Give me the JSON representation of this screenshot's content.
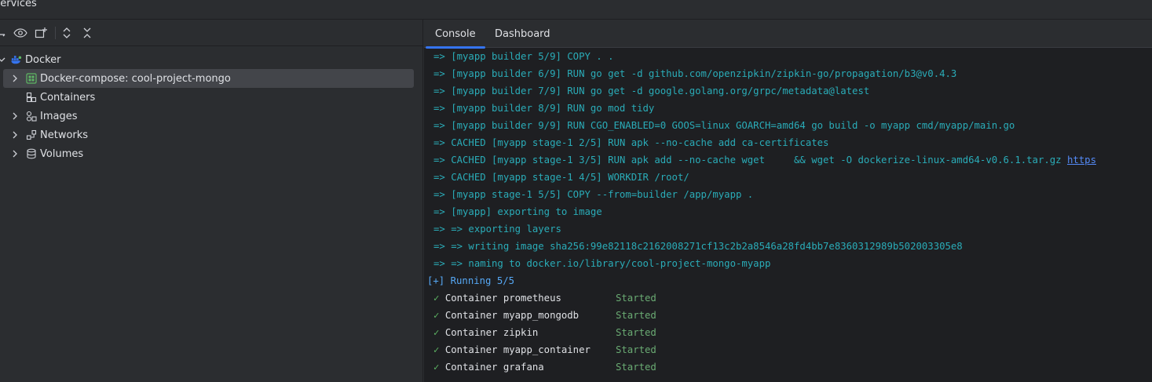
{
  "window": {
    "title": "Services"
  },
  "toolbar": {
    "buttons": [
      {
        "name": "collapse-option-icon"
      },
      {
        "name": "eye-icon"
      },
      {
        "name": "new-group-icon"
      },
      {
        "name": "expand-all-icon"
      },
      {
        "name": "collapse-all-icon"
      }
    ]
  },
  "tree": {
    "root": {
      "label": "Docker",
      "icon": "docker-icon"
    },
    "items": [
      {
        "label": "Docker-compose: cool-project-mongo",
        "icon": "compose-icon",
        "expandable": true,
        "selected": true
      },
      {
        "label": "Containers",
        "icon": "containers-icon",
        "expandable": false
      },
      {
        "label": "Images",
        "icon": "images-icon",
        "expandable": true
      },
      {
        "label": "Networks",
        "icon": "networks-icon",
        "expandable": true
      },
      {
        "label": "Volumes",
        "icon": "volumes-icon",
        "expandable": true
      }
    ]
  },
  "tabs": [
    {
      "label": "Console",
      "active": true
    },
    {
      "label": "Dashboard",
      "active": false
    }
  ],
  "console": {
    "build_lines": [
      "=> [myapp builder 5/9] COPY . .",
      "=> [myapp builder 6/9] RUN go get -d github.com/openzipkin/zipkin-go/propagation/b3@v0.4.3",
      "=> [myapp builder 7/9] RUN go get -d google.golang.org/grpc/metadata@latest",
      "=> [myapp builder 8/9] RUN go mod tidy",
      "=> [myapp builder 9/9] RUN CGO_ENABLED=0 GOOS=linux GOARCH=amd64 go build -o myapp cmd/myapp/main.go",
      "=> CACHED [myapp stage-1 2/5] RUN apk --no-cache add ca-certificates",
      "=> CACHED [myapp stage-1 3/5] RUN apk add --no-cache wget     && wget -O dockerize-linux-amd64-v0.6.1.tar.gz ",
      "=> CACHED [myapp stage-1 4/5] WORKDIR /root/",
      "=> [myapp stage-1 5/5] COPY --from=builder /app/myapp .",
      "=> [myapp] exporting to image",
      "=> => exporting layers",
      "=> => writing image sha256:99e82118c2162008271cf13c2b2a8546a28fd4bb7e8360312989b502003305e8",
      "=> => naming to docker.io/library/cool-project-mongo-myapp"
    ],
    "link_text": "https",
    "running": "[+] Running 5/5",
    "check": "✓",
    "containers": [
      {
        "label": "Container prometheus",
        "status": "Started"
      },
      {
        "label": "Container myapp_mongodb",
        "status": "Started"
      },
      {
        "label": "Container zipkin",
        "status": "Started"
      },
      {
        "label": "Container myapp_container",
        "status": "Started"
      },
      {
        "label": "Container grafana",
        "status": "Started"
      }
    ]
  }
}
